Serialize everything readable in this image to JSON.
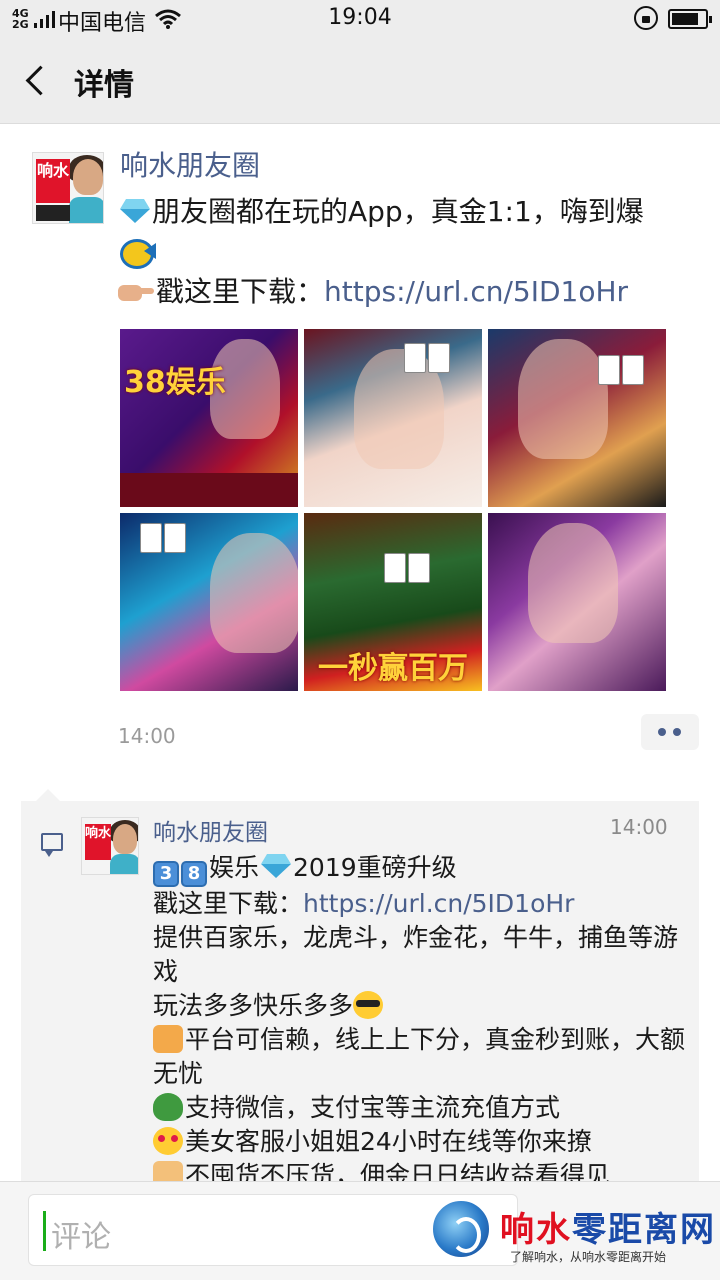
{
  "status_bar": {
    "network": "4G 2G",
    "carrier": "中国电信",
    "time": "19:04"
  },
  "nav": {
    "title": "详情",
    "back_icon": "chevron-left-icon"
  },
  "post": {
    "author": "响水朋友圈",
    "avatar_text": "响水",
    "line1": "朋友圈都在玩的App，真金1:1，嗨到爆",
    "link_prefix": "戳这里下载：",
    "link": "https://url.cn/5ID1oHr",
    "images": [
      {
        "text": "38娱乐"
      },
      {
        "text": ""
      },
      {
        "text": ""
      },
      {
        "text": ""
      },
      {
        "text": "一秒赢百万"
      },
      {
        "text": ""
      }
    ],
    "time": "14:00"
  },
  "comment": {
    "author": "响水朋友圈",
    "time": "14:00",
    "keycaps": [
      "3",
      "8"
    ],
    "line1": "娱乐",
    "line1b": "2019重磅升级",
    "link_prefix": "戳这里下载：",
    "link": "https://url.cn/5ID1oHr",
    "line3": "提供百家乐，龙虎斗，炸金花，牛牛，捕鱼等游戏",
    "line4": "玩法多多快乐多多",
    "line5": "平台可信赖，线上上下分，真金秒到账，大额无忧",
    "line6": "支持微信，支付宝等主流充值方式",
    "line7": "美女客服小姐姐24小时在线等你来撩",
    "line8": "不囤货不压货，佣金日日结收益看得见"
  },
  "bottom": {
    "placeholder": "评论"
  },
  "watermark": {
    "title_a": "响水",
    "title_b": "零距离网",
    "subtitle": "了解响水，从响水零距离开始"
  },
  "colors": {
    "link": "#4a5f8c",
    "nav_bg": "#ededed",
    "caret": "#1aad19"
  }
}
